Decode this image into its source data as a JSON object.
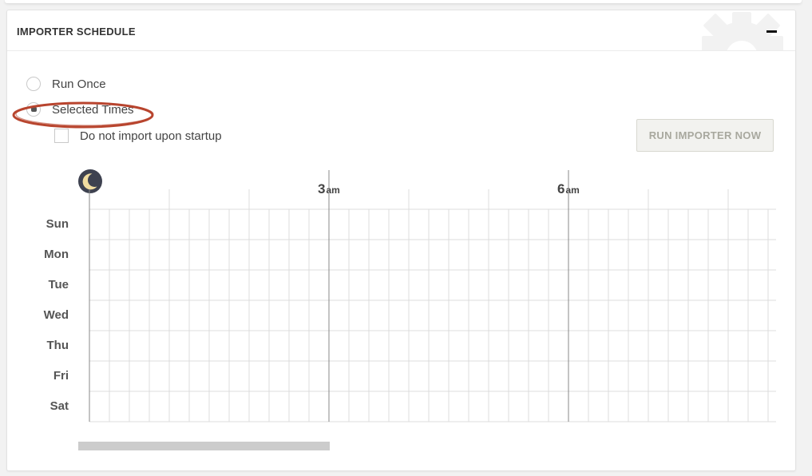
{
  "panel": {
    "title": "IMPORTER SCHEDULE",
    "collapse_symbol": "minus-icon",
    "watermark_icon": "gear-icon"
  },
  "mode_options": [
    {
      "label": "Run Once",
      "selected": false
    },
    {
      "label": "Selected Times",
      "selected": true
    }
  ],
  "startup_option": {
    "label": "Do not import upon startup",
    "checked": false
  },
  "run_button": {
    "label": "RUN IMPORTER NOW",
    "enabled": false
  },
  "schedule": {
    "night_icon": "moon-icon",
    "days": [
      "Sun",
      "Mon",
      "Tue",
      "Wed",
      "Thu",
      "Fri",
      "Sat"
    ],
    "hour_markers": [
      {
        "hour": "3",
        "suffix": "am"
      },
      {
        "hour": "6",
        "suffix": "am"
      }
    ],
    "colors": {
      "grid": "#dcdcdc",
      "major_line": "#888888",
      "moon": "#f0dca0",
      "moon_bg": "#3e4250"
    }
  },
  "annotation": {
    "highlight_color": "#b8452e"
  }
}
